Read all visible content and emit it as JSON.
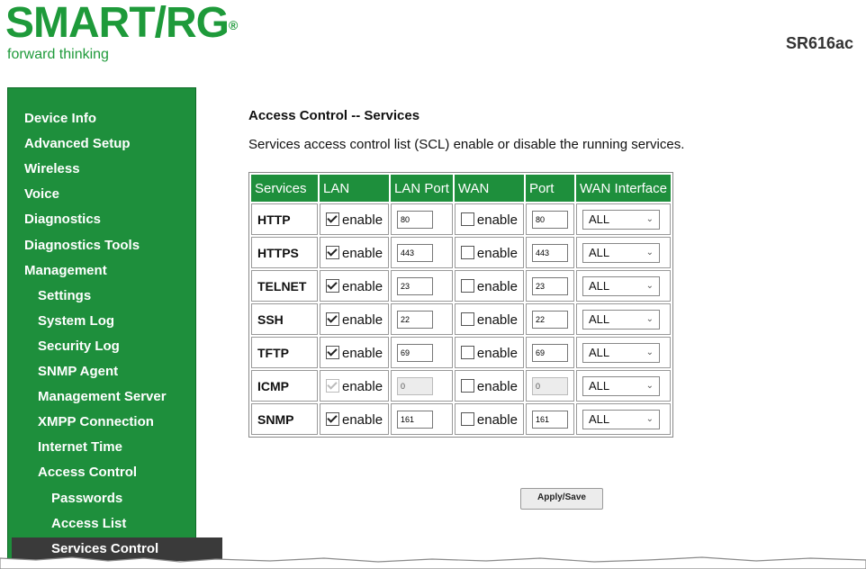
{
  "brand": {
    "logo_text": "SMART/RG",
    "logo_reg": "®",
    "tagline": "forward thinking",
    "model": "SR616ac",
    "color": "#1e9a3a"
  },
  "sidebar": {
    "color": "#1e8f3c",
    "items": [
      {
        "label": "Device Info",
        "level": 0
      },
      {
        "label": "Advanced Setup",
        "level": 0
      },
      {
        "label": "Wireless",
        "level": 0
      },
      {
        "label": "Voice",
        "level": 0
      },
      {
        "label": "Diagnostics",
        "level": 0
      },
      {
        "label": "Diagnostics Tools",
        "level": 0
      },
      {
        "label": "Management",
        "level": 0
      },
      {
        "label": "Settings",
        "level": 1
      },
      {
        "label": "System Log",
        "level": 1
      },
      {
        "label": "Security Log",
        "level": 1
      },
      {
        "label": "SNMP Agent",
        "level": 1
      },
      {
        "label": "Management Server",
        "level": 1
      },
      {
        "label": "XMPP Connection",
        "level": 1
      },
      {
        "label": "Internet Time",
        "level": 1
      },
      {
        "label": "Access Control",
        "level": 1
      },
      {
        "label": "Passwords",
        "level": 2
      },
      {
        "label": "Access List",
        "level": 2
      },
      {
        "label": "Services Control",
        "level": 2,
        "selected": true
      }
    ]
  },
  "main": {
    "title": "Access Control -- Services",
    "description": "Services access control list (SCL) enable or disable the running services.",
    "table": {
      "headers": [
        "Services",
        "LAN",
        "LAN Port",
        "WAN",
        "Port",
        "WAN Interface"
      ],
      "rows": [
        {
          "service": "HTTP",
          "lan_checked": true,
          "lan_disabled": false,
          "lan_label": "enable",
          "lan_port": "80",
          "lan_port_disabled": false,
          "wan_checked": false,
          "wan_label": "enable",
          "wan_port": "80",
          "wan_port_disabled": false,
          "wan_interface": "ALL"
        },
        {
          "service": "HTTPS",
          "lan_checked": true,
          "lan_disabled": false,
          "lan_label": "enable",
          "lan_port": "443",
          "lan_port_disabled": false,
          "wan_checked": false,
          "wan_label": "enable",
          "wan_port": "443",
          "wan_port_disabled": false,
          "wan_interface": "ALL"
        },
        {
          "service": "TELNET",
          "lan_checked": true,
          "lan_disabled": false,
          "lan_label": "enable",
          "lan_port": "23",
          "lan_port_disabled": false,
          "wan_checked": false,
          "wan_label": "enable",
          "wan_port": "23",
          "wan_port_disabled": false,
          "wan_interface": "ALL"
        },
        {
          "service": "SSH",
          "lan_checked": true,
          "lan_disabled": false,
          "lan_label": "enable",
          "lan_port": "22",
          "lan_port_disabled": false,
          "wan_checked": false,
          "wan_label": "enable",
          "wan_port": "22",
          "wan_port_disabled": false,
          "wan_interface": "ALL"
        },
        {
          "service": "TFTP",
          "lan_checked": true,
          "lan_disabled": false,
          "lan_label": "enable",
          "lan_port": "69",
          "lan_port_disabled": false,
          "wan_checked": false,
          "wan_label": "enable",
          "wan_port": "69",
          "wan_port_disabled": false,
          "wan_interface": "ALL"
        },
        {
          "service": "ICMP",
          "lan_checked": true,
          "lan_disabled": true,
          "lan_label": "enable",
          "lan_port": "0",
          "lan_port_disabled": true,
          "wan_checked": false,
          "wan_label": "enable",
          "wan_port": "0",
          "wan_port_disabled": true,
          "wan_interface": "ALL"
        },
        {
          "service": "SNMP",
          "lan_checked": true,
          "lan_disabled": false,
          "lan_label": "enable",
          "lan_port": "161",
          "lan_port_disabled": false,
          "wan_checked": false,
          "wan_label": "enable",
          "wan_port": "161",
          "wan_port_disabled": false,
          "wan_interface": "ALL"
        }
      ]
    },
    "apply_label": "Apply/Save"
  }
}
